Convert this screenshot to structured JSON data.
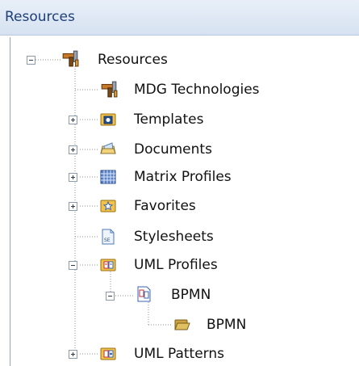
{
  "panel": {
    "title": "Resources"
  },
  "tree": {
    "root": "Resources",
    "items": [
      {
        "label": "MDG Technologies"
      },
      {
        "label": "Templates"
      },
      {
        "label": "Documents"
      },
      {
        "label": "Matrix Profiles"
      },
      {
        "label": "Favorites"
      },
      {
        "label": "Stylesheets"
      },
      {
        "label": "UML Profiles"
      },
      {
        "label": "BPMN"
      },
      {
        "label": "BPMN"
      },
      {
        "label": "UML Patterns"
      }
    ]
  }
}
